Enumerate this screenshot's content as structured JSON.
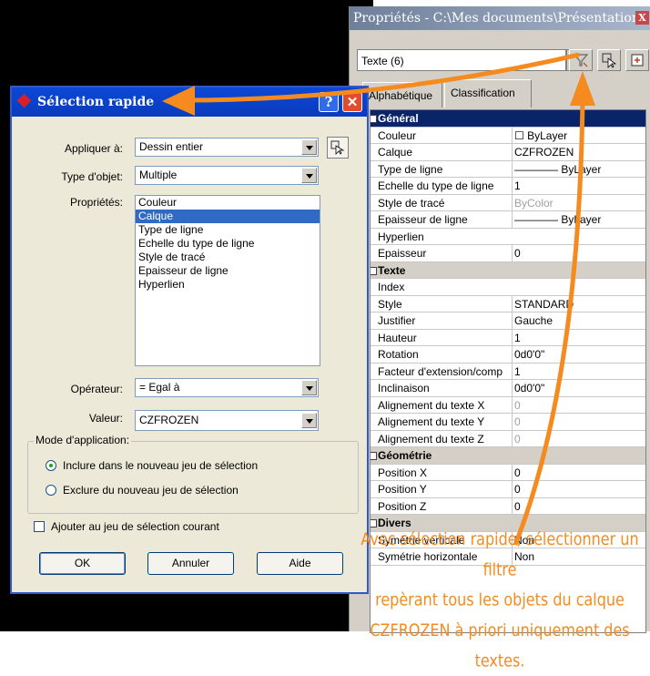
{
  "properties_palette": {
    "title": "Propriétés - C:\\Mes documents\\Présentations ...",
    "close_glyph": "X",
    "object_combo": "Texte (6)",
    "tabs": [
      "Alphabétique",
      "Classification"
    ],
    "rows": [
      {
        "type": "header",
        "label": "Général",
        "selected": true
      },
      {
        "key": "Couleur",
        "value": "☐ ByLayer"
      },
      {
        "key": "Calque",
        "value": "CZFROZEN"
      },
      {
        "key": "Type de ligne",
        "value": "———— ByLayer"
      },
      {
        "key": "Echelle du type de ligne",
        "value": "1"
      },
      {
        "key": "Style de tracé",
        "value": "ByColor",
        "grey": true
      },
      {
        "key": "Epaisseur de ligne",
        "value": "———— ByLayer"
      },
      {
        "key": "Hyperlien",
        "value": ""
      },
      {
        "key": "Epaisseur",
        "value": "0"
      },
      {
        "type": "header",
        "label": "Texte"
      },
      {
        "key": "Index",
        "value": ""
      },
      {
        "key": "Style",
        "value": "STANDARD"
      },
      {
        "key": "Justifier",
        "value": "Gauche"
      },
      {
        "key": "Hauteur",
        "value": "1"
      },
      {
        "key": "Rotation",
        "value": "0d0'0\""
      },
      {
        "key": "Facteur d'extension/comp",
        "value": "1"
      },
      {
        "key": "Inclinaison",
        "value": "0d0'0\""
      },
      {
        "key": "Alignement du texte X",
        "value": "0",
        "grey": true
      },
      {
        "key": "Alignement du texte Y",
        "value": "0",
        "grey": true
      },
      {
        "key": "Alignement du texte Z",
        "value": "0",
        "grey": true
      },
      {
        "type": "header",
        "label": "Géométrie"
      },
      {
        "key": "Position X",
        "value": "0"
      },
      {
        "key": "Position Y",
        "value": "0"
      },
      {
        "key": "Position Z",
        "value": "0"
      },
      {
        "type": "header",
        "label": "Divers"
      },
      {
        "key": "Symétrie verticale",
        "value": "Non"
      },
      {
        "key": "Symétrie horizontale",
        "value": "Non"
      }
    ]
  },
  "quick_select": {
    "title": "Sélection rapide",
    "help_glyph": "?",
    "close_glyph": "✕",
    "apply_to_label": "Appliquer à:",
    "apply_to_value": "Dessin entier",
    "object_type_label": "Type d'objet:",
    "object_type_value": "Multiple",
    "properties_label": "Propriétés:",
    "properties": [
      "Couleur",
      "Calque",
      "Type de ligne",
      "Echelle du type de ligne",
      "Style de tracé",
      "Epaisseur de ligne",
      "Hyperlien"
    ],
    "selected_property": "Calque",
    "operator_label": "Opérateur:",
    "operator_value": "= Egal à",
    "value_label": "Valeur:",
    "value_value": "CZFROZEN",
    "mode_label": "Mode d'application:",
    "mode_include": "Inclure dans le nouveau jeu de sélection",
    "mode_exclude": "Exclure du nouveau jeu de sélection",
    "append_label": "Ajouter au jeu de sélection courant",
    "ok_label": "OK",
    "cancel_label": "Annuler",
    "help_label": "Aide"
  },
  "annotation": {
    "lines": [
      "Avec sélection rapide, sélectionner un filtre",
      "repèrant tous les objets du calque",
      "CZFROZEN à priori uniquement des textes."
    ],
    "color": "#f58a1f"
  }
}
